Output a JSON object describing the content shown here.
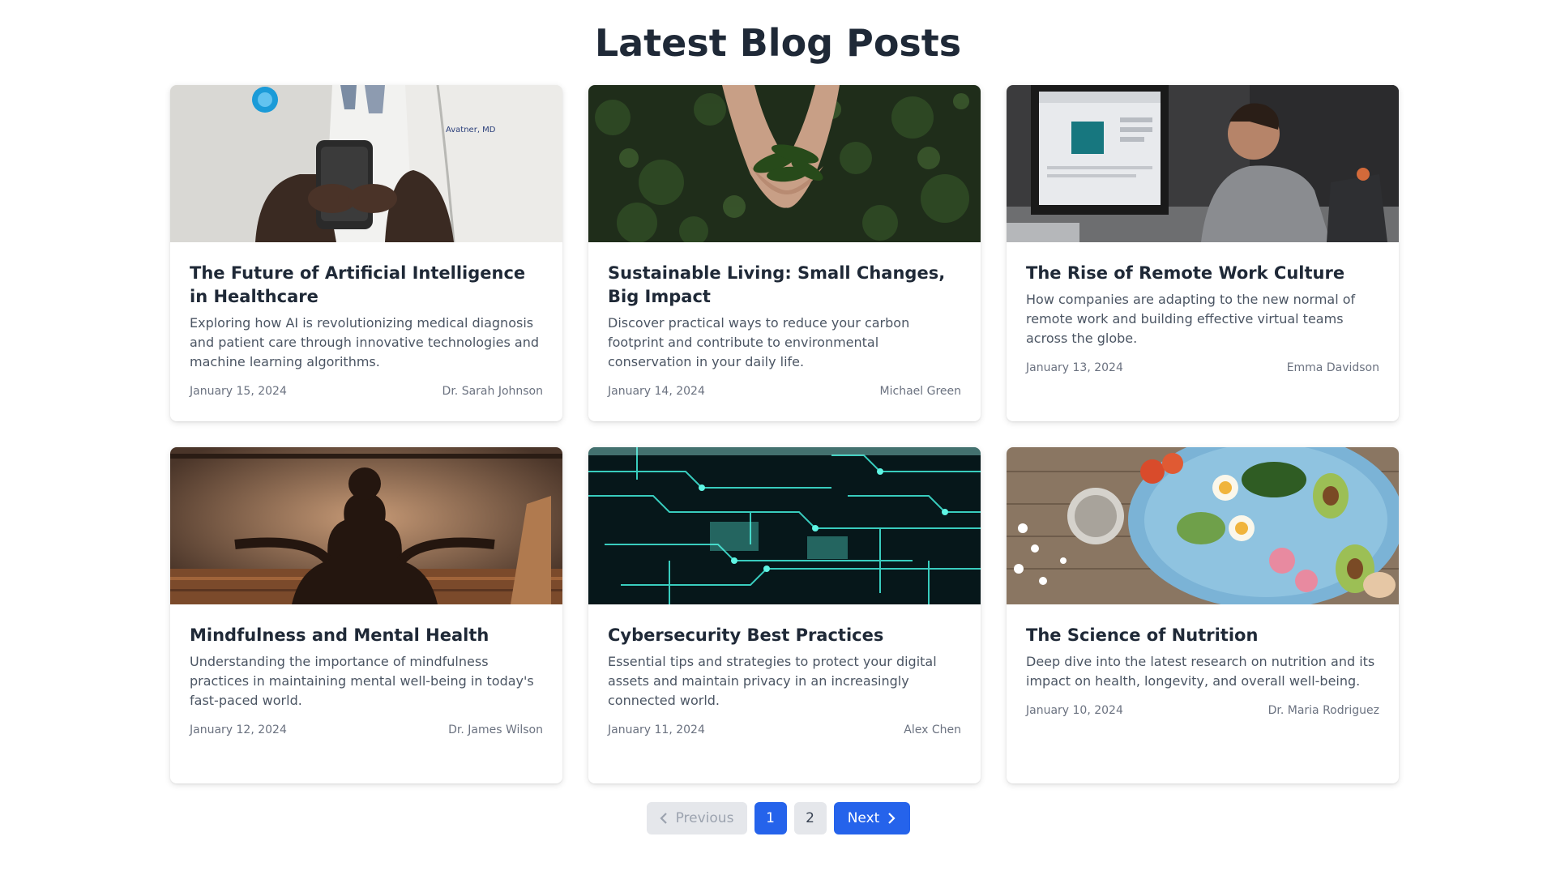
{
  "page": {
    "title": "Latest Blog Posts"
  },
  "posts": [
    {
      "title": "The Future of Artificial Intelligence in Healthcare",
      "excerpt": "Exploring how AI is revolutionizing medical diagnosis and patient care through innovative technologies and machine learning algorithms.",
      "date": "January 15, 2024",
      "author": "Dr. Sarah Johnson",
      "image": "doctor-holding-smartphone"
    },
    {
      "title": "Sustainable Living: Small Changes, Big Impact",
      "excerpt": "Discover practical ways to reduce your carbon footprint and contribute to environmental conservation in your daily life.",
      "date": "January 14, 2024",
      "author": "Michael Green",
      "image": "hands-holding-fern"
    },
    {
      "title": "The Rise of Remote Work Culture",
      "excerpt": "How companies are adapting to the new normal of remote work and building effective virtual teams across the globe.",
      "date": "January 13, 2024",
      "author": "Emma Davidson",
      "image": "man-at-computer"
    },
    {
      "title": "Mindfulness and Mental Health",
      "excerpt": "Understanding the importance of mindfulness practices in maintaining mental well-being in today's fast-paced world.",
      "date": "January 12, 2024",
      "author": "Dr. James Wilson",
      "image": "meditation-silhouette"
    },
    {
      "title": "Cybersecurity Best Practices",
      "excerpt": "Essential tips and strategies to protect your digital assets and maintain privacy in an increasingly connected world.",
      "date": "January 11, 2024",
      "author": "Alex Chen",
      "image": "circuit-board"
    },
    {
      "title": "The Science of Nutrition",
      "excerpt": "Deep dive into the latest research on nutrition and its impact on health, longevity, and overall well-being.",
      "date": "January 10, 2024",
      "author": "Dr. Maria Rodriguez",
      "image": "healthy-food-plate"
    }
  ],
  "pagination": {
    "previous_label": "Previous",
    "next_label": "Next",
    "pages": [
      "1",
      "2"
    ],
    "current_page": "1"
  },
  "colors": {
    "accent": "#2563eb",
    "disabled_bg": "#e5e7eb",
    "heading": "#1f2937"
  }
}
